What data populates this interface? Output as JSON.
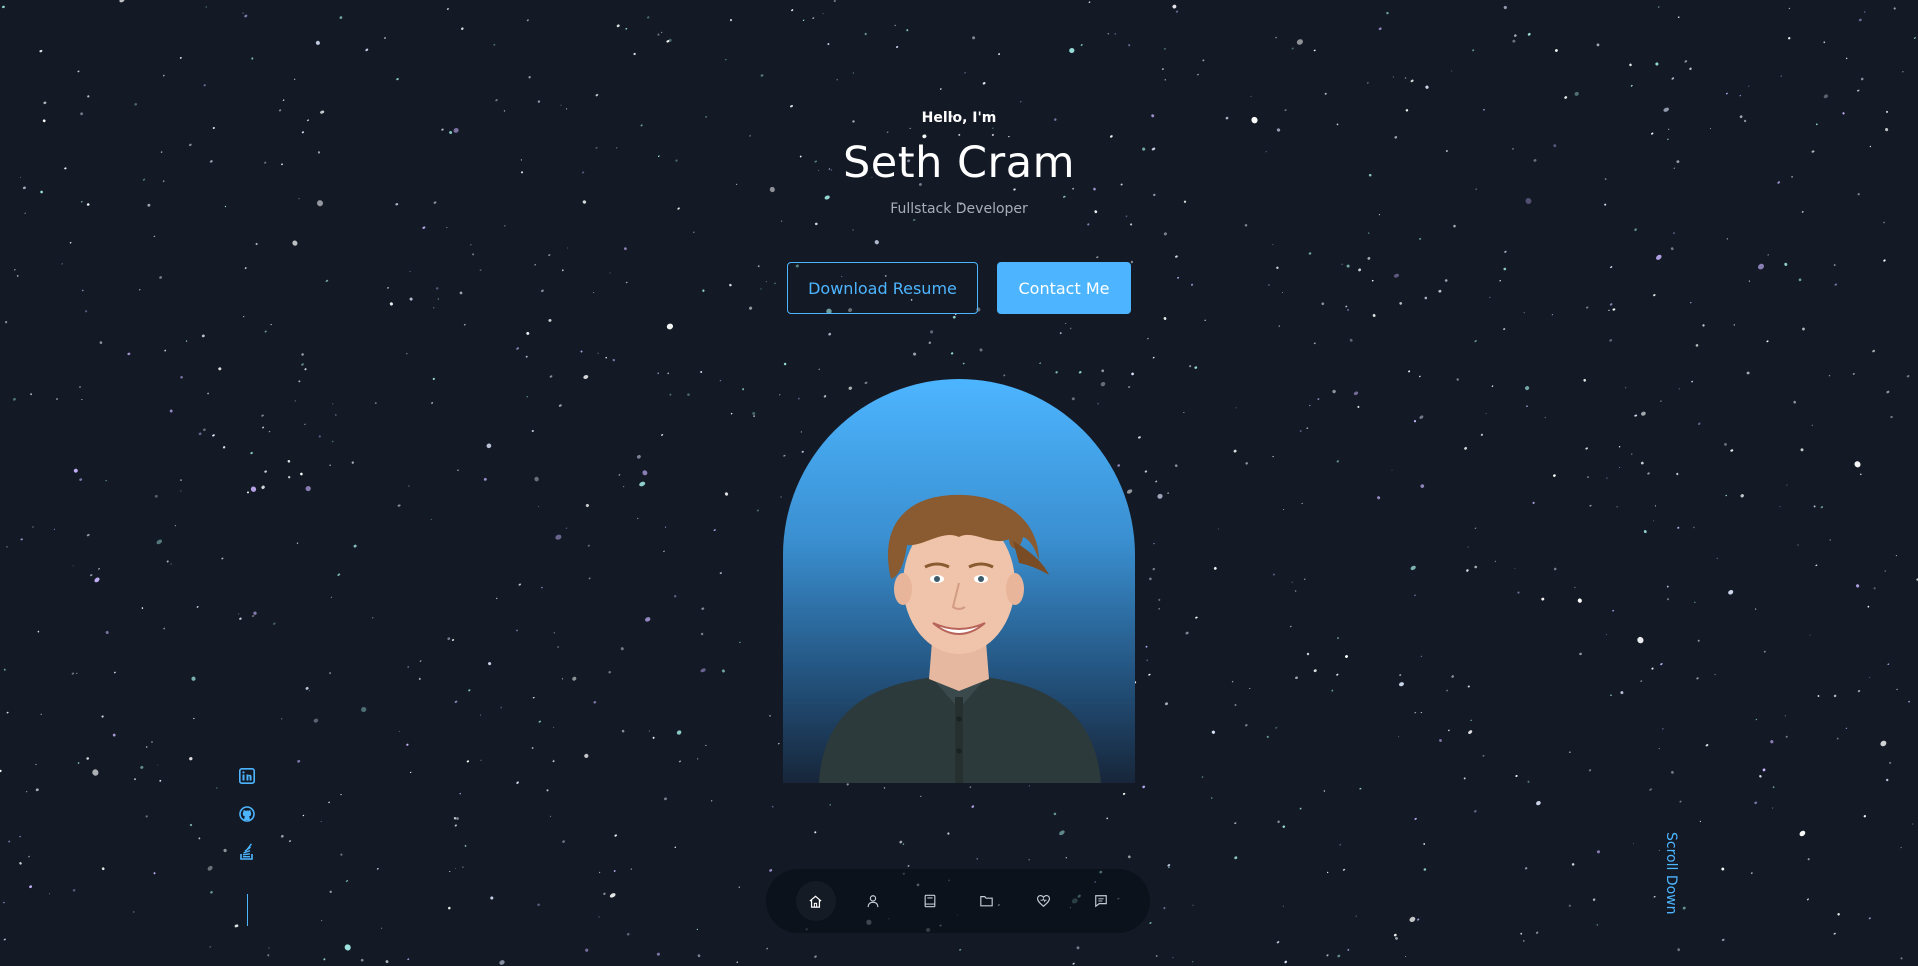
{
  "hero": {
    "greeting": "Hello, I'm",
    "name": "Seth Cram",
    "role": "Fullstack Developer",
    "buttons": {
      "download": "Download Resume",
      "contact": "Contact Me"
    }
  },
  "portrait": {
    "alt_description_icon": "profile-photo",
    "gradient_top": "#4db5ff"
  },
  "socials": [
    {
      "icon": "linkedin-icon"
    },
    {
      "icon": "github-icon"
    },
    {
      "icon": "stackoverflow-icon"
    }
  ],
  "scroll": {
    "label": "Scroll Down"
  },
  "nav": {
    "items": [
      {
        "icon": "home-icon",
        "active": true
      },
      {
        "icon": "user-icon",
        "active": false
      },
      {
        "icon": "book-icon",
        "active": false
      },
      {
        "icon": "folder-icon",
        "active": false
      },
      {
        "icon": "heart-icon",
        "active": false
      },
      {
        "icon": "message-icon",
        "active": false
      }
    ]
  },
  "colors": {
    "accent": "#4db5ff",
    "background": "#131a26",
    "text": "#ffffff",
    "muted": "#a8adb8"
  }
}
